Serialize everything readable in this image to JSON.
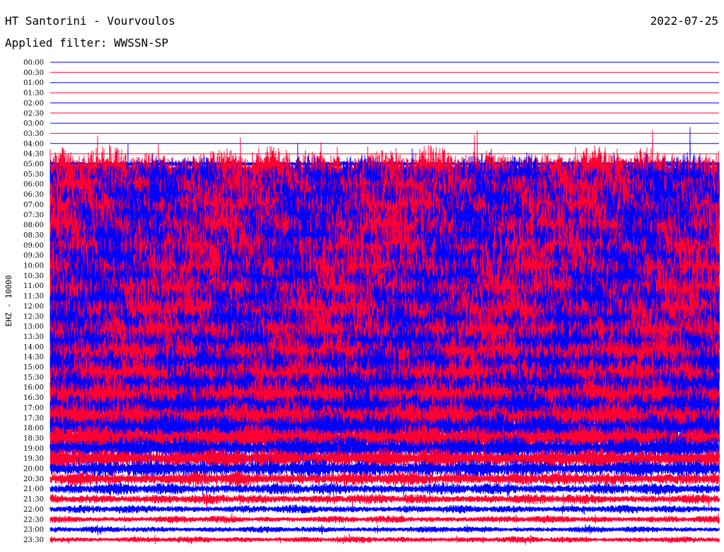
{
  "header": {
    "station": "HT Santorini - Vourvoulos",
    "date": "2022-07-25",
    "filter_label": "Applied filter: WWSSN-SP"
  },
  "chart_data": {
    "type": "line",
    "title": "HT Santorini - Vourvoulos",
    "subtitle": "Applied filter: WWSSN-SP",
    "ylabel": "EHZ - 10000",
    "xlabel": "",
    "row_labels": [
      "00:00",
      "00:30",
      "01:00",
      "01:30",
      "02:00",
      "02:30",
      "03:00",
      "03:30",
      "04:00",
      "04:30",
      "05:00",
      "05:30",
      "06:00",
      "06:30",
      "07:00",
      "07:30",
      "08:00",
      "08:30",
      "09:00",
      "09:30",
      "10:00",
      "10:30",
      "11:00",
      "11:30",
      "12:00",
      "12:30",
      "13:00",
      "13:30",
      "14:00",
      "14:30",
      "15:00",
      "15:30",
      "16:00",
      "16:30",
      "17:00",
      "17:30",
      "18:00",
      "18:30",
      "19:00",
      "19:30",
      "20:00",
      "20:30",
      "21:00",
      "21:30",
      "22:00",
      "22:30",
      "23:00",
      "23:30"
    ],
    "colors": [
      "#0000ff",
      "#ff0033"
    ],
    "amplitude_profile": [
      0,
      0,
      0,
      0,
      0,
      0,
      0,
      0,
      0,
      0,
      0.3,
      3.0,
      3.2,
      3.4,
      3.6,
      3.6,
      3.7,
      3.6,
      3.6,
      3.5,
      3.5,
      3.4,
      3.4,
      3.3,
      3.2,
      3.1,
      3.0,
      2.9,
      2.8,
      2.7,
      2.6,
      2.5,
      2.4,
      2.3,
      2.1,
      2.0,
      1.8,
      1.6,
      1.4,
      1.2,
      1.0,
      0.8,
      0.65,
      0.55,
      0.45,
      0.4,
      0.35,
      0.35
    ],
    "grid": false
  }
}
